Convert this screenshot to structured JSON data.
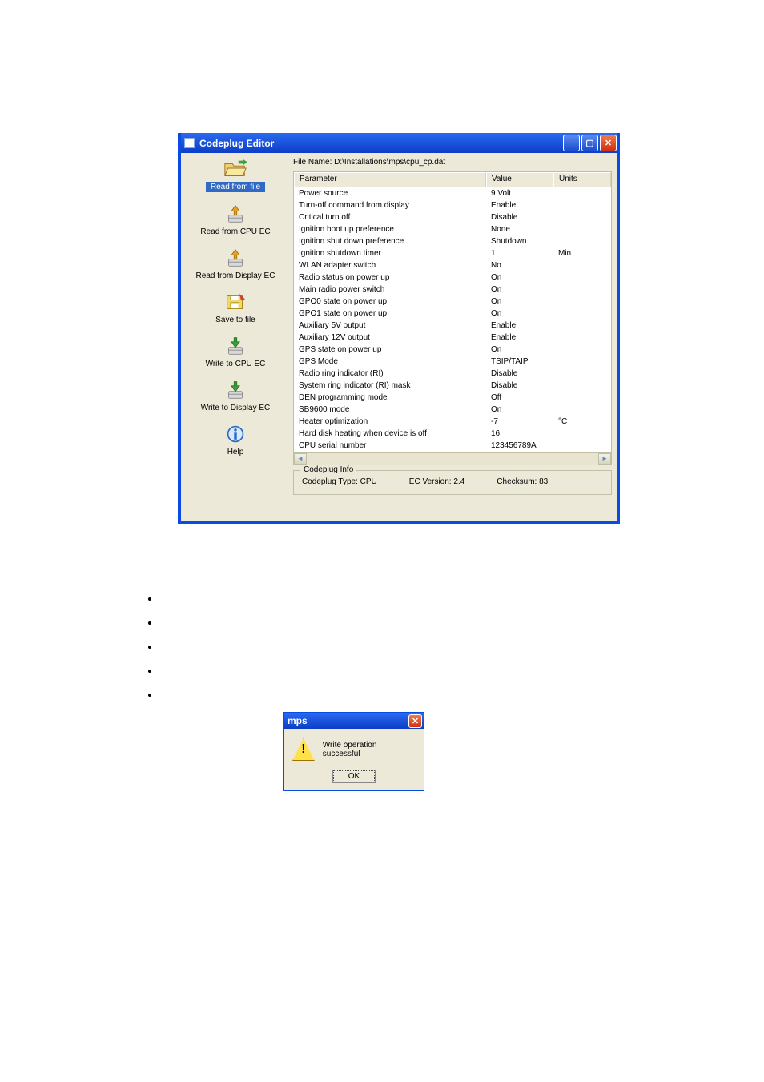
{
  "window": {
    "title": "Codeplug Editor"
  },
  "sidebar": {
    "items": [
      {
        "label": "Read from file",
        "icon": "folder-open",
        "selected": true
      },
      {
        "label": "Read from CPU EC",
        "icon": "arrow-up-box",
        "selected": false
      },
      {
        "label": "Read from Display EC",
        "icon": "arrow-up-box",
        "selected": false
      },
      {
        "label": "Save to file",
        "icon": "floppy-write",
        "selected": false
      },
      {
        "label": "Write to CPU EC",
        "icon": "arrow-down-box",
        "selected": false
      },
      {
        "label": "Write to Display EC",
        "icon": "arrow-down-box",
        "selected": false
      },
      {
        "label": "Help",
        "icon": "info",
        "selected": false
      }
    ]
  },
  "filename_label": "File Name:",
  "filename_value": "D:\\Installations\\mps\\cpu_cp.dat",
  "columns": {
    "param": "Parameter",
    "value": "Value",
    "units": "Units"
  },
  "rows": [
    {
      "param": "Power source",
      "value": "9 Volt",
      "units": ""
    },
    {
      "param": "Turn-off command from display",
      "value": "Enable",
      "units": ""
    },
    {
      "param": "Critical turn off",
      "value": "Disable",
      "units": ""
    },
    {
      "param": "Ignition boot up preference",
      "value": "None",
      "units": ""
    },
    {
      "param": "Ignition shut down preference",
      "value": "Shutdown",
      "units": ""
    },
    {
      "param": "Ignition shutdown timer",
      "value": "1",
      "units": "Min"
    },
    {
      "param": "WLAN adapter switch",
      "value": "No",
      "units": ""
    },
    {
      "param": "Radio status on power up",
      "value": "On",
      "units": ""
    },
    {
      "param": "Main radio power switch",
      "value": "On",
      "units": ""
    },
    {
      "param": "GPO0 state on power up",
      "value": "On",
      "units": ""
    },
    {
      "param": "GPO1 state on power up",
      "value": "On",
      "units": ""
    },
    {
      "param": "Auxiliary 5V output",
      "value": "Enable",
      "units": ""
    },
    {
      "param": "Auxiliary 12V output",
      "value": "Enable",
      "units": ""
    },
    {
      "param": "GPS state on power up",
      "value": "On",
      "units": ""
    },
    {
      "param": "GPS Mode",
      "value": "TSIP/TAIP",
      "units": ""
    },
    {
      "param": "Radio ring indicator (RI)",
      "value": "Disable",
      "units": ""
    },
    {
      "param": "System ring indicator (RI) mask",
      "value": "Disable",
      "units": ""
    },
    {
      "param": "DEN programming mode",
      "value": "Off",
      "units": ""
    },
    {
      "param": "SB9600 mode",
      "value": "On",
      "units": ""
    },
    {
      "param": "Heater optimization",
      "value": "-7",
      "units": "°C"
    },
    {
      "param": "Hard disk heating when device is off",
      "value": "16",
      "units": ""
    },
    {
      "param": "CPU serial number",
      "value": "123456789A",
      "units": ""
    }
  ],
  "info": {
    "legend": "Codeplug Info",
    "type_label": "Codeplug Type:",
    "type_value": "CPU",
    "version_label": "EC Version:",
    "version_value": "2.4",
    "checksum_label": "Checksum:",
    "checksum_value": "83"
  },
  "dialog": {
    "title": "mps",
    "message": "Write operation successful",
    "ok": "OK"
  }
}
